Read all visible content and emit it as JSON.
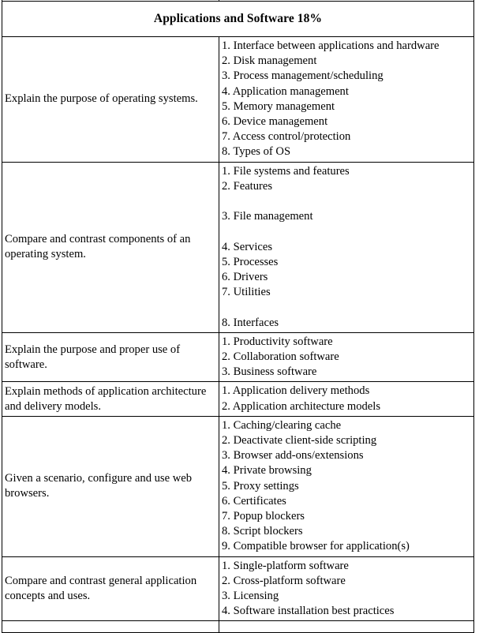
{
  "document": {
    "section_heading": "Applications and Software 18%"
  },
  "table": {
    "rows": [
      {
        "objective": "Explain the purpose of operating systems.",
        "examples": [
          {
            "text": "1. Interface between applications and hardware",
            "gap_before": false
          },
          {
            "text": "2. Disk management",
            "gap_before": false
          },
          {
            "text": "3. Process management/scheduling",
            "gap_before": false
          },
          {
            "text": "4. Application management",
            "gap_before": false
          },
          {
            "text": "5. Memory management",
            "gap_before": false
          },
          {
            "text": "6. Device management",
            "gap_before": false
          },
          {
            "text": "7. Access control/protection",
            "gap_before": false
          },
          {
            "text": "8. Types of OS",
            "gap_before": false
          }
        ]
      },
      {
        "objective": "Compare and contrast components of an operating system.",
        "examples": [
          {
            "text": "1. File systems and features",
            "gap_before": false
          },
          {
            "text": "2. Features",
            "gap_before": false
          },
          {
            "text": "3. File management",
            "gap_before": true
          },
          {
            "text": "4. Services",
            "gap_before": true
          },
          {
            "text": "5. Processes",
            "gap_before": false
          },
          {
            "text": "6. Drivers",
            "gap_before": false
          },
          {
            "text": "7. Utilities",
            "gap_before": false
          },
          {
            "text": "8. Interfaces",
            "gap_before": true
          }
        ]
      },
      {
        "objective": "Explain the purpose and proper use of software.",
        "examples": [
          {
            "text": "1. Productivity software",
            "gap_before": false
          },
          {
            "text": "2. Collaboration software",
            "gap_before": false
          },
          {
            "text": "3. Business software",
            "gap_before": false
          }
        ]
      },
      {
        "objective": "Explain methods of application architecture and delivery models.",
        "examples": [
          {
            "text": "1. Application delivery methods",
            "gap_before": false
          },
          {
            "text": "2. Application architecture models",
            "gap_before": false
          }
        ]
      },
      {
        "objective": "Given a scenario,  configure and use web browsers.",
        "examples": [
          {
            "text": "1. Caching/clearing cache",
            "gap_before": false
          },
          {
            "text": "2. Deactivate client-side scripting",
            "gap_before": false
          },
          {
            "text": "3. Browser add-ons/extensions",
            "gap_before": false
          },
          {
            "text": "4. Private browsing",
            "gap_before": false
          },
          {
            "text": "5. Proxy settings",
            "gap_before": false
          },
          {
            "text": "6. Certificates",
            "gap_before": false
          },
          {
            "text": "7. Popup blockers",
            "gap_before": false
          },
          {
            "text": "8. Script blockers",
            "gap_before": false
          },
          {
            "text": "9. Compatible browser for application(s)",
            "gap_before": false
          }
        ]
      },
      {
        "objective": "Compare and contrast general application concepts and uses.",
        "examples": [
          {
            "text": "1. Single-platform software",
            "gap_before": false
          },
          {
            "text": "2. Cross-platform software",
            "gap_before": false
          },
          {
            "text": "3. Licensing",
            "gap_before": false
          },
          {
            "text": "4. Software installation best practices",
            "gap_before": false
          }
        ]
      }
    ]
  }
}
